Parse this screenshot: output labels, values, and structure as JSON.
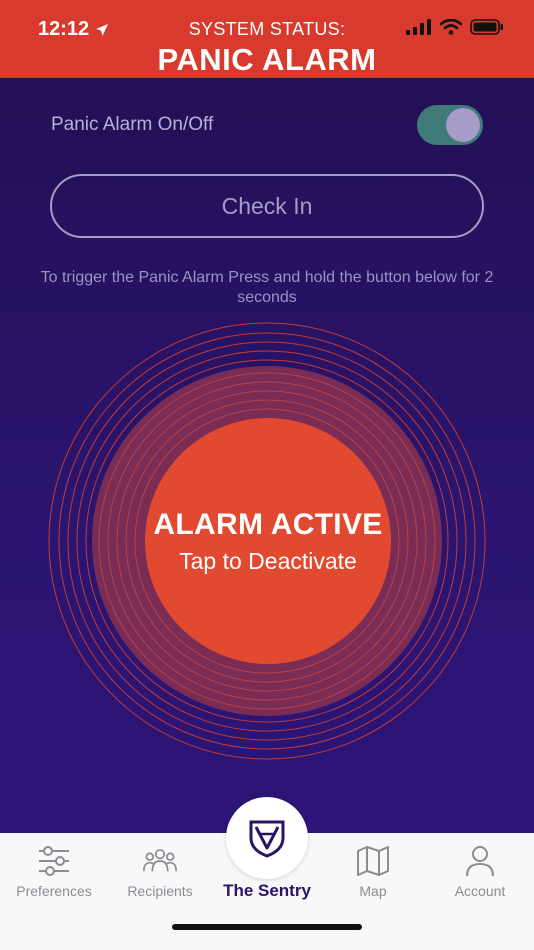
{
  "status_bar": {
    "time": "12:12"
  },
  "header": {
    "status_label": "SYSTEM STATUS:",
    "title": "PANIC ALARM"
  },
  "panic_toggle": {
    "label": "Panic Alarm On/Off",
    "state": "on"
  },
  "check_in": {
    "label": "Check In"
  },
  "instructions": "To trigger the Panic Alarm Press and hold the button below for 2 seconds",
  "alarm": {
    "title": "ALARM ACTIVE",
    "subtitle": "Tap to Deactivate"
  },
  "tabs": [
    {
      "label": "Preferences",
      "icon": "sliders-icon"
    },
    {
      "label": "Recipients",
      "icon": "people-icon"
    },
    {
      "label": "The Sentry",
      "icon": "shield-icon",
      "active": true
    },
    {
      "label": "Map",
      "icon": "map-icon"
    },
    {
      "label": "Account",
      "icon": "person-icon"
    }
  ],
  "colors": {
    "header": "#d93a2e",
    "background": "#2a1166",
    "alarm": "#e14a30",
    "toggle_on": "#3f7b78",
    "active_tab": "#2a1466"
  }
}
